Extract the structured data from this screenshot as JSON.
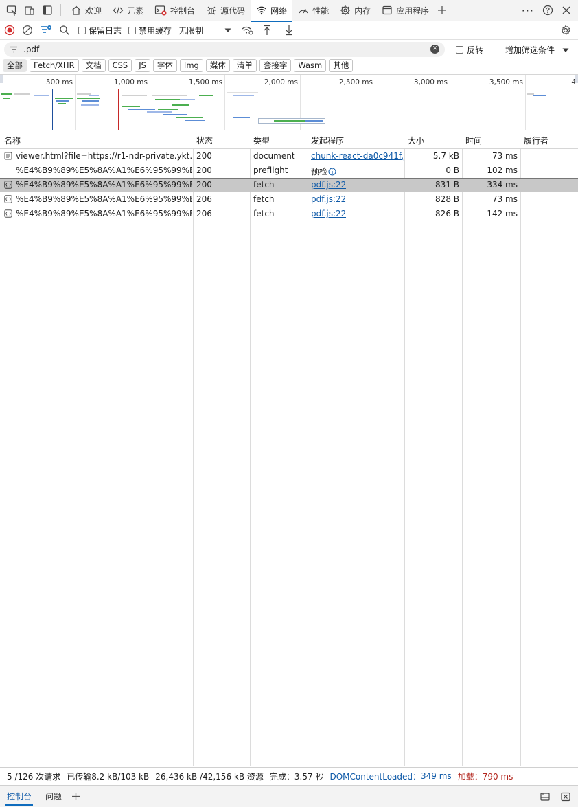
{
  "tabs": [
    {
      "label": "欢迎",
      "icon": "home-icon"
    },
    {
      "label": "元素",
      "icon": "code-icon"
    },
    {
      "label": "控制台",
      "icon": "console-icon"
    },
    {
      "label": "源代码",
      "icon": "bug-icon"
    },
    {
      "label": "网络",
      "icon": "wifi-icon",
      "active": true
    },
    {
      "label": "性能",
      "icon": "performance-icon"
    },
    {
      "label": "内存",
      "icon": "memory-icon"
    },
    {
      "label": "应用程序",
      "icon": "application-icon"
    }
  ],
  "toolbar": {
    "preserve_log": "保留日志",
    "disable_cache": "禁用缓存",
    "throttle": "无限制"
  },
  "filter": {
    "value": ".pdf",
    "invert": "反转",
    "more_filters": "增加筛选条件"
  },
  "chips": [
    "全部",
    "Fetch/XHR",
    "文档",
    "CSS",
    "JS",
    "字体",
    "Img",
    "媒体",
    "清单",
    "套接字",
    "Wasm",
    "其他"
  ],
  "overview": {
    "ticks": [
      "500 ms",
      "1,000 ms",
      "1,500 ms",
      "2,000 ms",
      "2,500 ms",
      "3,000 ms",
      "3,500 ms",
      "4"
    ]
  },
  "table": {
    "columns": [
      "名称",
      "状态",
      "类型",
      "发起程序",
      "大小",
      "时间",
      "履行者"
    ],
    "rows": [
      {
        "name": "viewer.html?file=https://r1-ndr-private.ykt....",
        "status": "200",
        "type": "document",
        "initiator": "chunk-react-da0c941f.js",
        "size": "5.7 kB",
        "time": "73 ms",
        "icon": "document-icon"
      },
      {
        "name": "%E4%B9%89%E5%8A%A1%E6%95%99%E...",
        "status": "200",
        "type": "preflight",
        "initiator": "预检",
        "size": "0 B",
        "time": "102 ms",
        "icon": ""
      },
      {
        "name": "%E4%B9%89%E5%8A%A1%E6%95%99%E...",
        "status": "200",
        "type": "fetch",
        "initiator": "pdf.js:22",
        "size": "831 B",
        "time": "334 ms",
        "icon": "fetch-icon"
      },
      {
        "name": "%E4%B9%89%E5%8A%A1%E6%95%99%E...",
        "status": "206",
        "type": "fetch",
        "initiator": "pdf.js:22",
        "size": "828 B",
        "time": "73 ms",
        "icon": "fetch-icon"
      },
      {
        "name": "%E4%B9%89%E5%8A%A1%E6%95%99%E...",
        "status": "206",
        "type": "fetch",
        "initiator": "pdf.js:22",
        "size": "826 B",
        "time": "142 ms",
        "icon": "fetch-icon"
      }
    ]
  },
  "status": {
    "requests": "5 /126 次请求",
    "transferred": "已传输8.2 kB/103 kB",
    "resources": "26,436 kB /42,156 kB 资源",
    "finish": "完成：3.57 秒",
    "dom_label": "DOMContentLoaded：",
    "dom_value": "349 ms",
    "load": "加载：790 ms"
  },
  "drawer": {
    "tabs": [
      "控制台",
      "问题"
    ]
  },
  "colors": {
    "accent": "#0f6cbd",
    "record": "#d32f2f",
    "link": "#0f5aa8"
  }
}
